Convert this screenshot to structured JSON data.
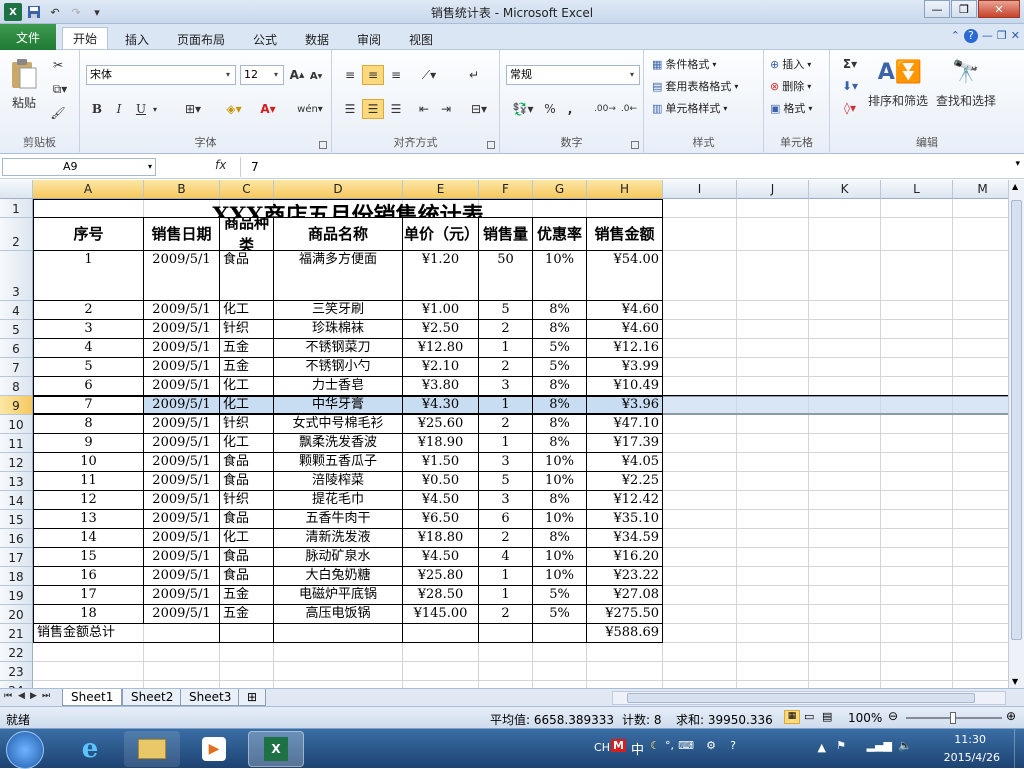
{
  "window": {
    "title": "销售统计表 - Microsoft Excel"
  },
  "tabs": {
    "file": "文件",
    "items": [
      "开始",
      "插入",
      "页面布局",
      "公式",
      "数据",
      "审阅",
      "视图"
    ]
  },
  "ribbon": {
    "clipboard": {
      "label": "剪贴板",
      "paste": "粘贴"
    },
    "font": {
      "label": "字体",
      "name": "宋体",
      "size": "12",
      "bold": "B",
      "italic": "I",
      "underline": "U"
    },
    "alignment": {
      "label": "对齐方式"
    },
    "number": {
      "label": "数字",
      "format": "常规",
      "percent": "%",
      "comma": ","
    },
    "styles": {
      "label": "样式",
      "conditional": "条件格式",
      "table": "套用表格格式",
      "cell": "单元格样式"
    },
    "cells": {
      "label": "单元格",
      "insert": "插入",
      "delete": "删除",
      "format": "格式"
    },
    "editing": {
      "label": "编辑",
      "sort": "排序和筛选",
      "find": "查找和选择"
    }
  },
  "formula_bar": {
    "name_box": "A9",
    "fx": "fx",
    "value": "7"
  },
  "columns": [
    "A",
    "B",
    "C",
    "D",
    "E",
    "F",
    "G",
    "H",
    "I",
    "J",
    "K",
    "L",
    "M"
  ],
  "rows": [
    "1",
    "2",
    "3",
    "4",
    "5",
    "6",
    "7",
    "8",
    "9",
    "10",
    "11",
    "12",
    "13",
    "14",
    "15",
    "16",
    "17",
    "18",
    "19",
    "20",
    "21",
    "22",
    "23",
    "24"
  ],
  "sheet": {
    "title": "XXX商店五月份销售统计表",
    "headers": [
      "序号",
      "销售日期",
      "商品种类",
      "商品名称",
      "单价（元）",
      "销售量",
      "优惠率",
      "销售金额"
    ],
    "rows": [
      [
        "1",
        "2009/5/1",
        "食品",
        "福满多方便面",
        "¥1.20",
        "50",
        "10%",
        "¥54.00"
      ],
      [
        "2",
        "2009/5/1",
        "化工",
        "三笑牙刷",
        "¥1.00",
        "5",
        "8%",
        "¥4.60"
      ],
      [
        "3",
        "2009/5/1",
        "针织",
        "珍珠棉袜",
        "¥2.50",
        "2",
        "8%",
        "¥4.60"
      ],
      [
        "4",
        "2009/5/1",
        "五金",
        "不锈钢菜刀",
        "¥12.80",
        "1",
        "5%",
        "¥12.16"
      ],
      [
        "5",
        "2009/5/1",
        "五金",
        "不锈钢小勺",
        "¥2.10",
        "2",
        "5%",
        "¥3.99"
      ],
      [
        "6",
        "2009/5/1",
        "化工",
        "力士香皂",
        "¥3.80",
        "3",
        "8%",
        "¥10.49"
      ],
      [
        "7",
        "2009/5/1",
        "化工",
        "中华牙膏",
        "¥4.30",
        "1",
        "8%",
        "¥3.96"
      ],
      [
        "8",
        "2009/5/1",
        "针织",
        "女式中号棉毛衫",
        "¥25.60",
        "2",
        "8%",
        "¥47.10"
      ],
      [
        "9",
        "2009/5/1",
        "化工",
        "飘柔洗发香波",
        "¥18.90",
        "1",
        "8%",
        "¥17.39"
      ],
      [
        "10",
        "2009/5/1",
        "食品",
        "颗颗五香瓜子",
        "¥1.50",
        "3",
        "10%",
        "¥4.05"
      ],
      [
        "11",
        "2009/5/1",
        "食品",
        "涪陵榨菜",
        "¥0.50",
        "5",
        "10%",
        "¥2.25"
      ],
      [
        "12",
        "2009/5/1",
        "针织",
        "提花毛巾",
        "¥4.50",
        "3",
        "8%",
        "¥12.42"
      ],
      [
        "13",
        "2009/5/1",
        "食品",
        "五香牛肉干",
        "¥6.50",
        "6",
        "10%",
        "¥35.10"
      ],
      [
        "14",
        "2009/5/1",
        "化工",
        "清新洗发液",
        "¥18.80",
        "2",
        "8%",
        "¥34.59"
      ],
      [
        "15",
        "2009/5/1",
        "食品",
        "脉动矿泉水",
        "¥4.50",
        "4",
        "10%",
        "¥16.20"
      ],
      [
        "16",
        "2009/5/1",
        "食品",
        "大白兔奶糖",
        "¥25.80",
        "1",
        "10%",
        "¥23.22"
      ],
      [
        "17",
        "2009/5/1",
        "五金",
        "电磁炉平底锅",
        "¥28.50",
        "1",
        "5%",
        "¥27.08"
      ],
      [
        "18",
        "2009/5/1",
        "五金",
        "高压电饭锅",
        "¥145.00",
        "2",
        "5%",
        "¥275.50"
      ]
    ],
    "total_label": "销售金额总计",
    "total_value": "¥588.69"
  },
  "sheet_tabs": [
    "Sheet1",
    "Sheet2",
    "Sheet3"
  ],
  "status": {
    "ready": "就绪",
    "average": "平均值: 6658.389333",
    "count": "计数: 8",
    "sum": "求和: 39950.336",
    "zoom": "100%"
  },
  "tray": {
    "ime": "CH",
    "ime2": "中",
    "time": "11:30",
    "date": "2015/4/26"
  }
}
